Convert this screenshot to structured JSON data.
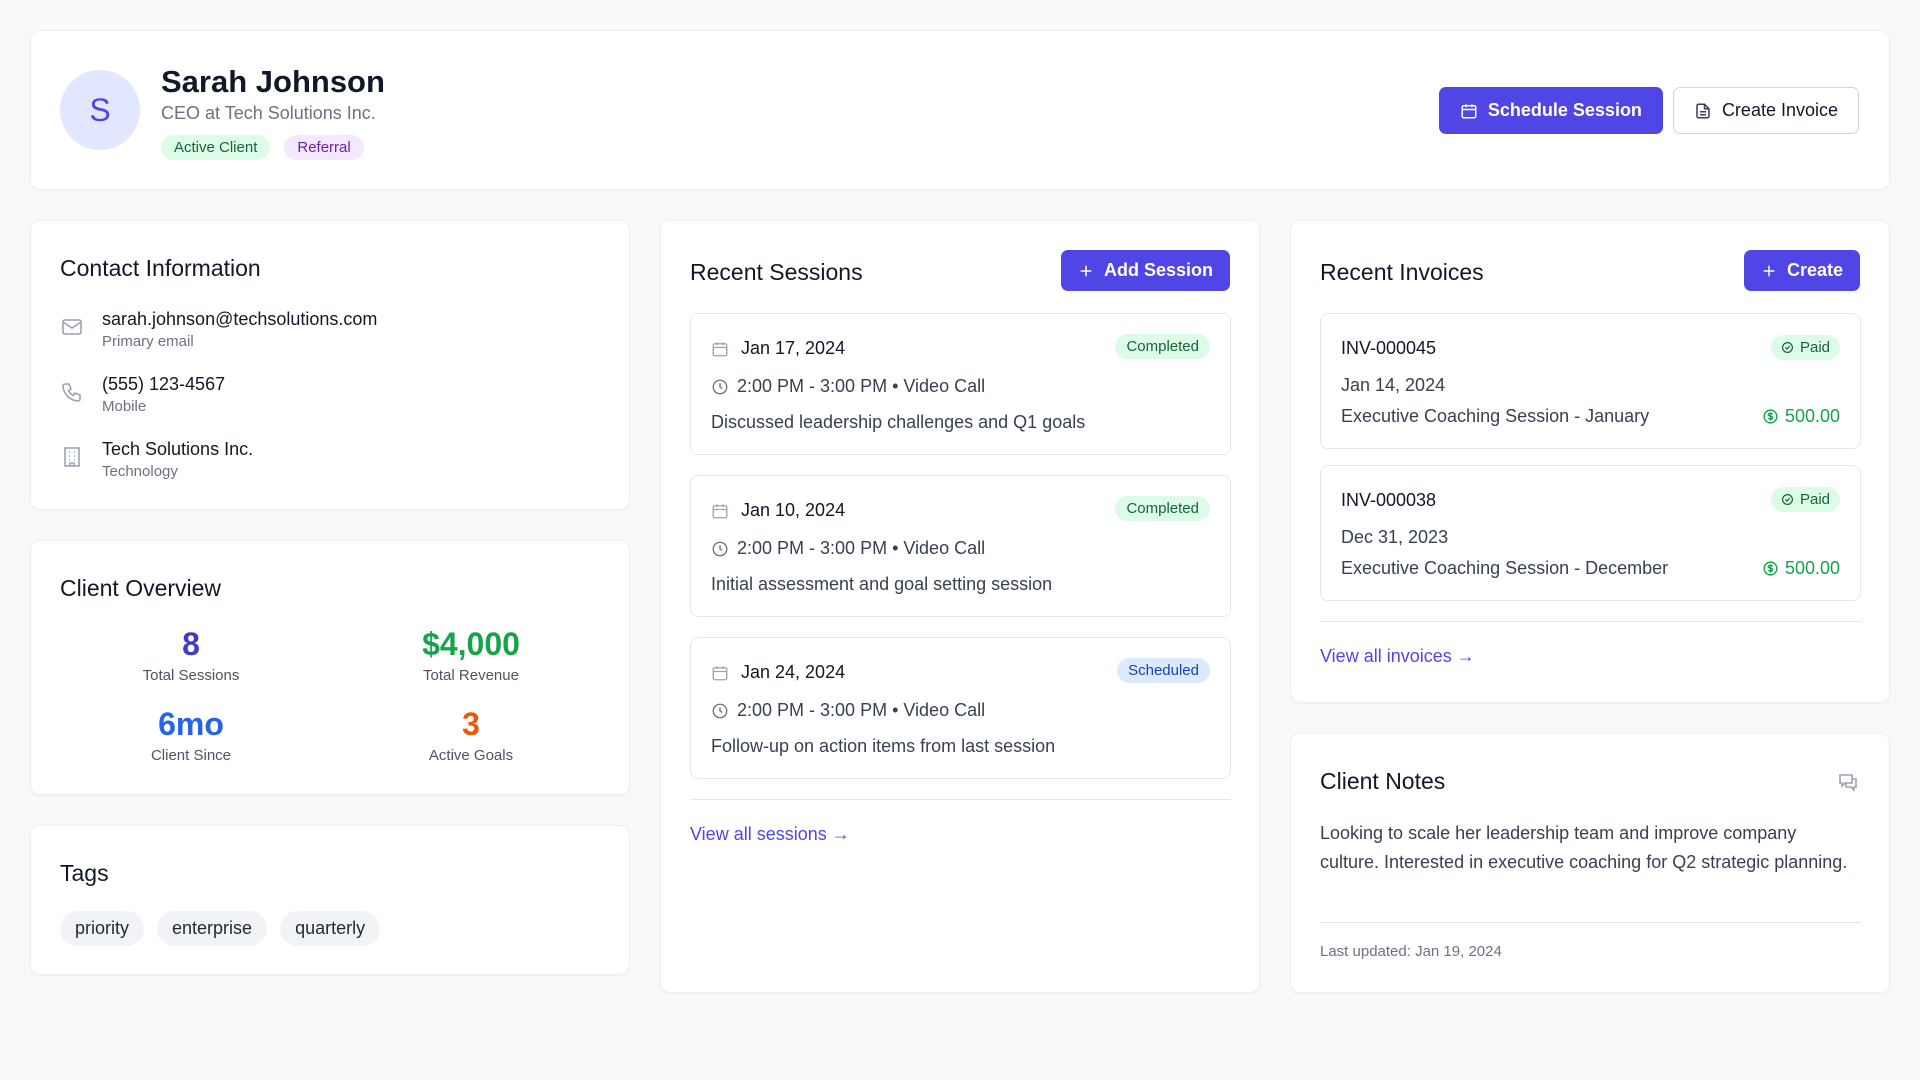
{
  "client": {
    "initial": "S",
    "name": "Sarah Johnson",
    "role": "CEO at Tech Solutions Inc.",
    "badges": [
      "Active Client",
      "Referral"
    ]
  },
  "header_actions": {
    "schedule_label": "Schedule Session",
    "invoice_label": "Create Invoice"
  },
  "contact": {
    "title": "Contact Information",
    "items": [
      {
        "value": "sarah.johnson@techsolutions.com",
        "sub": "Primary email",
        "icon": "mail-icon"
      },
      {
        "value": "(555) 123-4567",
        "sub": "Mobile",
        "icon": "phone-icon"
      },
      {
        "value": "Tech Solutions Inc.",
        "sub": "Technology",
        "icon": "building-icon"
      }
    ]
  },
  "overview": {
    "title": "Client Overview",
    "stats": [
      {
        "value": "8",
        "label": "Total Sessions",
        "color": "#4338ca"
      },
      {
        "value": "$4,000",
        "label": "Total Revenue",
        "color": "#16a34a"
      },
      {
        "value": "6mo",
        "label": "Client Since",
        "color": "#2563eb"
      },
      {
        "value": "3",
        "label": "Active Goals",
        "color": "#ea580c"
      }
    ]
  },
  "tags": {
    "title": "Tags",
    "items": [
      "priority",
      "enterprise",
      "quarterly"
    ]
  },
  "sessions": {
    "title": "Recent Sessions",
    "add_label": "Add Session",
    "items": [
      {
        "date": "Jan 17, 2024",
        "time": "2:00 PM - 3:00 PM • Video Call",
        "desc": "Discussed leadership challenges and Q1 goals",
        "status": "Completed"
      },
      {
        "date": "Jan 10, 2024",
        "time": "2:00 PM - 3:00 PM • Video Call",
        "desc": "Initial assessment and goal setting session",
        "status": "Completed"
      },
      {
        "date": "Jan 24, 2024",
        "time": "2:00 PM - 3:00 PM • Video Call",
        "desc": "Follow-up on action items from last session",
        "status": "Scheduled"
      }
    ],
    "view_all": "View all sessions →"
  },
  "invoices": {
    "title": "Recent Invoices",
    "create_label": "Create",
    "items": [
      {
        "number": "INV-000045",
        "date": "Jan 14, 2024",
        "desc": "Executive Coaching Session - January",
        "status": "Paid",
        "amount": "500.00"
      },
      {
        "number": "INV-000038",
        "date": "Dec 31, 2023",
        "desc": "Executive Coaching Session - December",
        "status": "Paid",
        "amount": "500.00"
      }
    ],
    "view_all": "View all invoices →"
  },
  "notes": {
    "title": "Client Notes",
    "text": "Looking to scale her leadership team and improve company culture. Interested in executive coaching for Q2 strategic planning.",
    "updated": "Last updated: Jan 19, 2024"
  }
}
